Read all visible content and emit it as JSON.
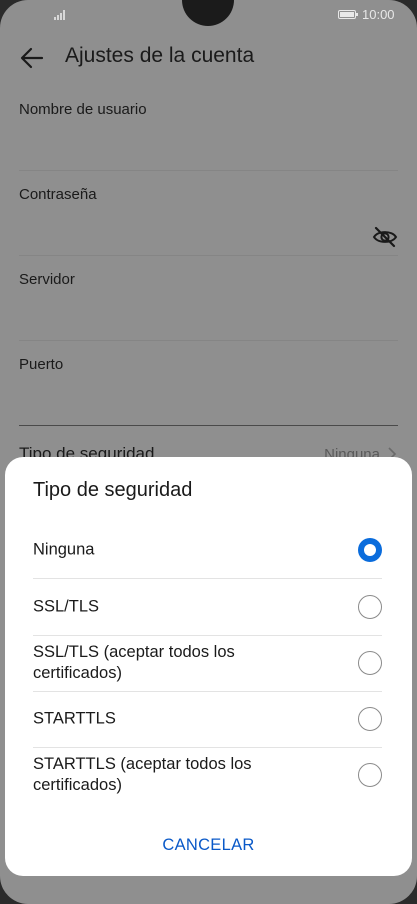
{
  "status_bar": {
    "time": "10:00",
    "signal_icon": "signal-icon",
    "battery_icon": "battery-icon"
  },
  "header": {
    "title": "Ajustes de la cuenta",
    "back_icon": "back-arrow-icon"
  },
  "form": {
    "fields": [
      {
        "label": "Nombre de usuario",
        "value": ""
      },
      {
        "label": "Contraseña",
        "value": "",
        "toggle_icon": "eye-off-icon"
      },
      {
        "label": "Servidor",
        "value": ""
      },
      {
        "label": "Puerto",
        "value": ""
      }
    ],
    "security": {
      "label": "Tipo de seguridad",
      "value": "Ninguna"
    }
  },
  "dialog": {
    "title": "Tipo de seguridad",
    "options": [
      {
        "label": "Ninguna",
        "selected": true
      },
      {
        "label": "SSL/TLS",
        "selected": false
      },
      {
        "label": "SSL/TLS (aceptar todos los certificados)",
        "selected": false
      },
      {
        "label": "STARTTLS",
        "selected": false
      },
      {
        "label": "STARTTLS (aceptar todos los certificados)",
        "selected": false
      }
    ],
    "cancel_label": "CANCELAR"
  },
  "colors": {
    "accent": "#0A6CDC",
    "scrim": "#8F8F8F",
    "dialog_bg": "#FFFFFF"
  }
}
